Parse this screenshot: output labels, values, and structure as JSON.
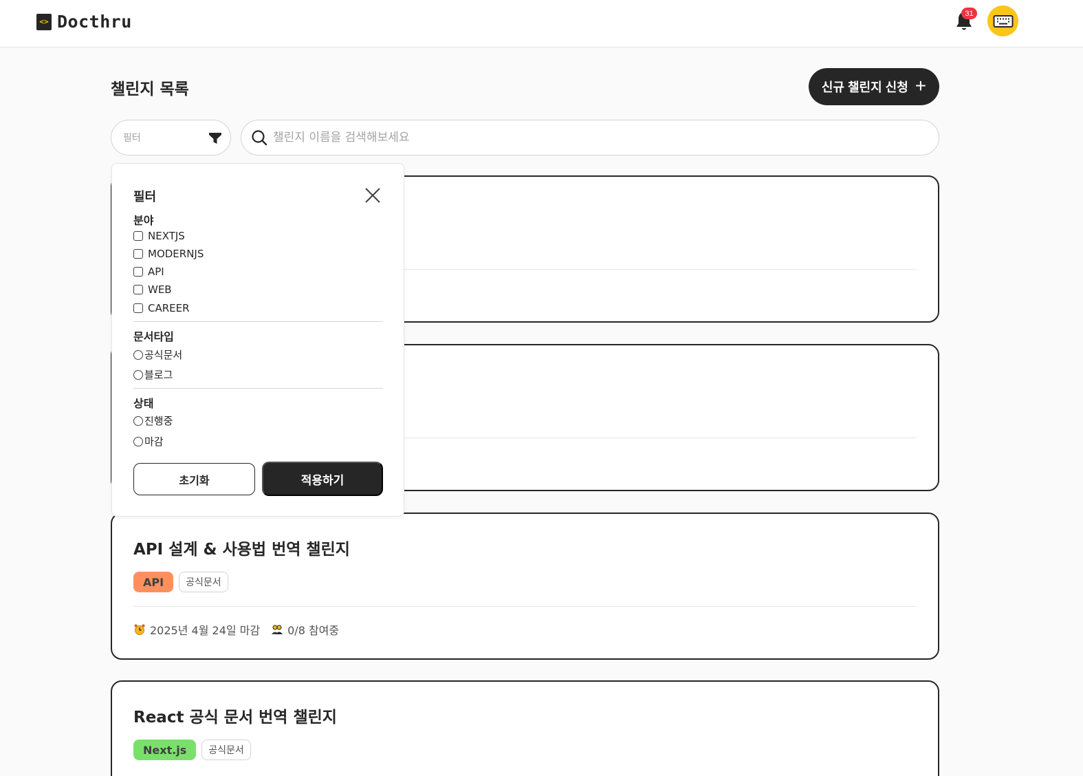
{
  "header": {
    "logo_mark": "<>",
    "logo_text": "Docthru",
    "notification_count": "31"
  },
  "page": {
    "title": "챌린지 목록",
    "new_challenge_label": "신규 챌린지 신청",
    "new_challenge_icon": "+"
  },
  "filter_select": {
    "placeholder": "필터"
  },
  "search": {
    "placeholder": "챌린지 이름을 검색해보세요",
    "value": ""
  },
  "filter_panel": {
    "title": "필터",
    "field_title": "분야",
    "fields": [
      "NEXTJS",
      "MODERNJS",
      "API",
      "WEB",
      "CAREER"
    ],
    "doctype_title": "문서타입",
    "doctypes": [
      "공식문서",
      "블로그"
    ],
    "status_title": "상태",
    "statuses": [
      "진행중",
      "마감"
    ],
    "reset_label": "초기화",
    "apply_label": "적용하기"
  },
  "cards": [
    {},
    {},
    {
      "title": "API 설계 & 사용법 번역 챌린지",
      "category": "API",
      "category_color": "#ff905e",
      "doc_type": "공식문서",
      "deadline": "2025년 4월 24일 마감",
      "participants": "0/8 참여중"
    },
    {
      "title": "React 공식 문서 번역 챌린지",
      "category": "Next.js",
      "category_color": "#79e16a",
      "doc_type": "공식문서"
    }
  ],
  "colors": {
    "accent_dark": "#262626",
    "avatar_bg": "#fbc51a",
    "badge_red": "#ef3340"
  },
  "icons": {
    "bell": "bell-icon",
    "avatar": "keyboard-icon",
    "filter": "filter-icon",
    "search": "search-icon",
    "close": "close-icon",
    "deadline": "alarm-clock-icon",
    "participants": "people-icon"
  }
}
